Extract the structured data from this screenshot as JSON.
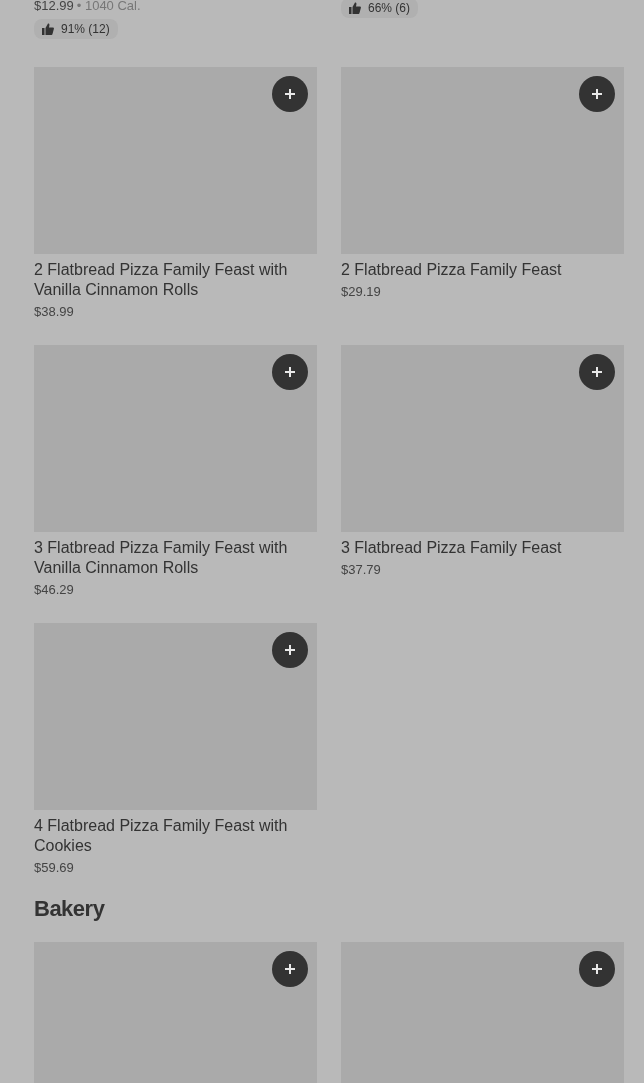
{
  "top_items": [
    {
      "price": "$12.99",
      "calories": "• 1040 Cal.",
      "rating": "91% (12)"
    },
    {
      "rating": "66% (6)"
    }
  ],
  "sections": [
    {
      "items": [
        {
          "add_button": true,
          "title": "2 Flatbread Pizza Family Feast with Vanilla Cinnamon Rolls",
          "price": "$38.99"
        },
        {
          "add_button": true,
          "title": "2 Flatbread Pizza Family Feast",
          "price": "$29.19"
        },
        {
          "add_button": true,
          "title": "3 Flatbread Pizza Family Feast with Vanilla Cinnamon Rolls",
          "price": "$46.29"
        },
        {
          "add_button": true,
          "title": "3 Flatbread Pizza Family Feast",
          "price": "$37.79"
        },
        {
          "add_button": true,
          "title": "4 Flatbread Pizza Family Feast with Cookies",
          "price": "$59.69"
        }
      ]
    },
    {
      "heading": "Bakery",
      "items": [
        {
          "add_button": true
        },
        {
          "add_button": true
        }
      ]
    }
  ]
}
